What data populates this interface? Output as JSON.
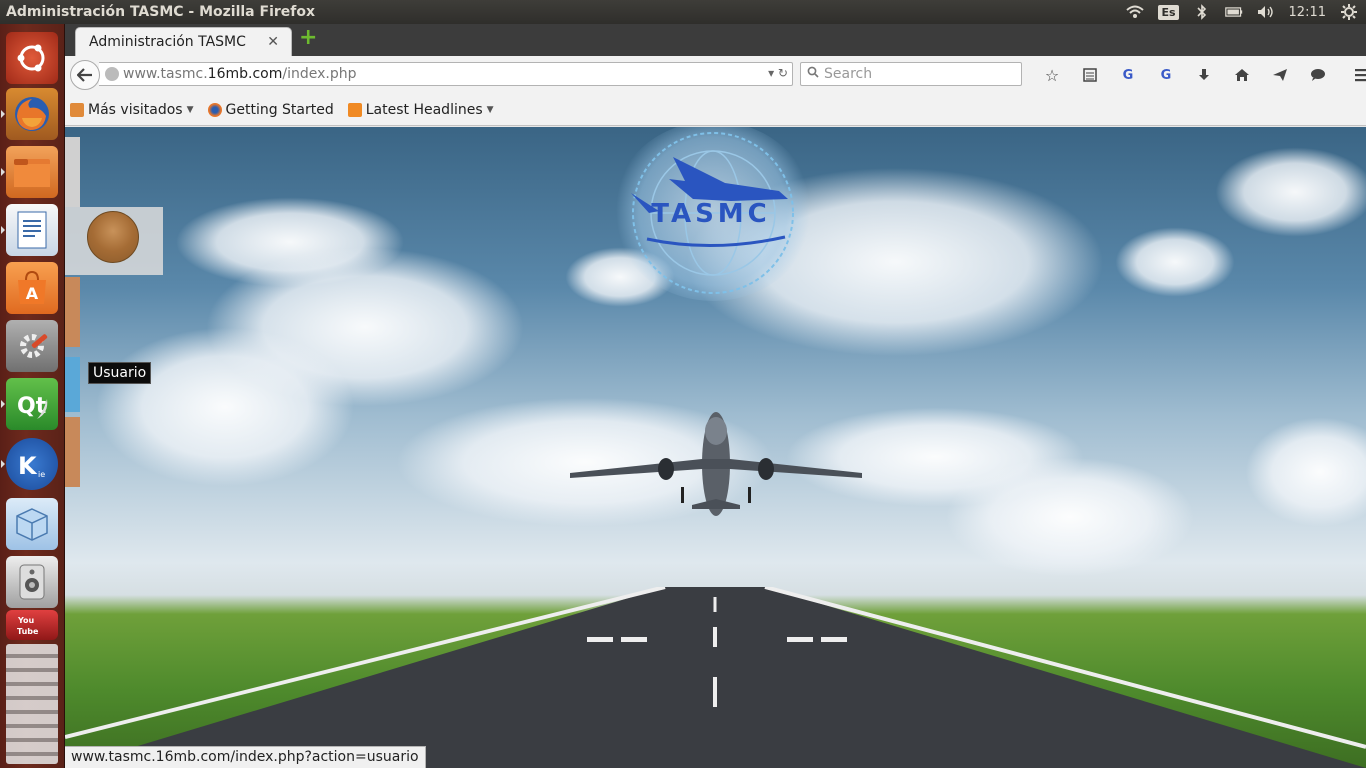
{
  "window_title": "Administración TASMC - Mozilla Firefox",
  "indicators": {
    "keyboard_layout": "Es",
    "clock": "12:11"
  },
  "launcher_items": [
    {
      "name": "dash-home-icon"
    },
    {
      "name": "firefox-icon"
    },
    {
      "name": "files-icon"
    },
    {
      "name": "libreoffice-writer-icon"
    },
    {
      "name": "software-center-icon"
    },
    {
      "name": "system-settings-icon"
    },
    {
      "name": "qt-creator-icon"
    },
    {
      "name": "komodo-edit-icon"
    },
    {
      "name": "virtualbox-icon"
    },
    {
      "name": "speaker-icon"
    },
    {
      "name": "youtube-icon"
    }
  ],
  "tab": {
    "label": "Administración TASMC",
    "close": "✕"
  },
  "url": {
    "host_prefix": "www.tasmc.",
    "host_domain": "16mb.com",
    "path": "/index.php"
  },
  "search": {
    "placeholder": "Search"
  },
  "bookmarks": [
    {
      "label": "Más visitados",
      "dropdown": true
    },
    {
      "label": "Getting Started",
      "dropdown": false
    },
    {
      "label": "Latest Headlines",
      "dropdown": true
    }
  ],
  "page": {
    "logo_text": "TASMC",
    "user_tooltip": "Usuario"
  },
  "status_url": "www.tasmc.16mb.com/index.php?action=usuario",
  "colors": {
    "launcher": "#6e2a1d",
    "topbar": "#3c3b37",
    "logo_blue": "#2a55c0"
  }
}
